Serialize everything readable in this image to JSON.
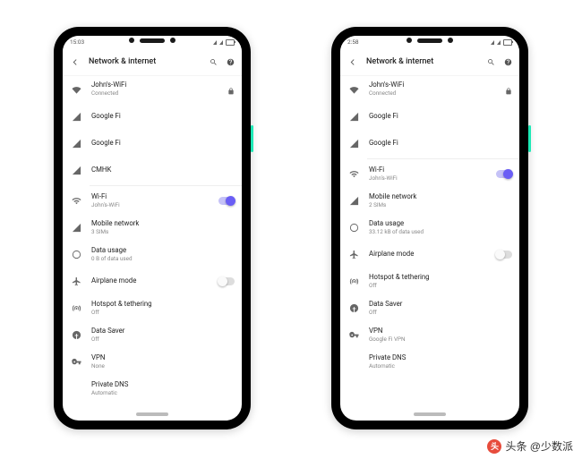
{
  "watermark": "头条 @少数派",
  "phones": [
    {
      "time": "15:03",
      "header_title": "Network & internet",
      "rows": [
        {
          "icon": "wifi-full",
          "label": "John's-WiFi",
          "sub": "Connected",
          "trail": "lock",
          "interact": true
        },
        {
          "icon": "signal",
          "label": "Google Fi",
          "sub": "",
          "trail": "",
          "interact": true
        },
        {
          "icon": "signal",
          "label": "Google Fi",
          "sub": "",
          "trail": "",
          "interact": true
        },
        {
          "icon": "signal",
          "label": "CMHK",
          "sub": "",
          "trail": "",
          "interact": true
        },
        {
          "sep": true
        },
        {
          "icon": "wifi",
          "label": "Wi-Fi",
          "sub": "John's-WiFi",
          "trail": "toggle-on",
          "interact": true
        },
        {
          "icon": "signal",
          "label": "Mobile network",
          "sub": "3 SIMs",
          "trail": "",
          "interact": true
        },
        {
          "icon": "data",
          "label": "Data usage",
          "sub": "0 B of data used",
          "trail": "",
          "interact": true
        },
        {
          "icon": "airplane",
          "label": "Airplane mode",
          "sub": "",
          "trail": "toggle-off",
          "interact": true
        },
        {
          "icon": "hotspot",
          "label": "Hotspot & tethering",
          "sub": "Off",
          "trail": "",
          "interact": true
        },
        {
          "icon": "datasaver",
          "label": "Data Saver",
          "sub": "Off",
          "trail": "",
          "interact": true
        },
        {
          "icon": "vpn",
          "label": "VPN",
          "sub": "None",
          "trail": "",
          "interact": true
        },
        {
          "icon": "indent",
          "label": "Private DNS",
          "sub": "Automatic",
          "trail": "",
          "interact": true
        }
      ]
    },
    {
      "time": "2:58",
      "header_title": "Network & internet",
      "rows": [
        {
          "icon": "wifi-full",
          "label": "John's-WiFi",
          "sub": "Connected",
          "trail": "lock",
          "interact": true
        },
        {
          "icon": "signal",
          "label": "Google Fi",
          "sub": "",
          "trail": "",
          "interact": true
        },
        {
          "icon": "signal",
          "label": "Google Fi",
          "sub": "",
          "trail": "",
          "interact": true
        },
        {
          "sep": true
        },
        {
          "icon": "wifi",
          "label": "Wi-Fi",
          "sub": "John's-WiFi",
          "trail": "toggle-on",
          "interact": true
        },
        {
          "icon": "signal",
          "label": "Mobile network",
          "sub": "2 SIMs",
          "trail": "",
          "interact": true
        },
        {
          "icon": "data",
          "label": "Data usage",
          "sub": "33.12 kB of data used",
          "trail": "",
          "interact": true
        },
        {
          "icon": "airplane",
          "label": "Airplane mode",
          "sub": "",
          "trail": "toggle-off",
          "interact": true
        },
        {
          "icon": "hotspot",
          "label": "Hotspot & tethering",
          "sub": "Off",
          "trail": "",
          "interact": true
        },
        {
          "icon": "datasaver",
          "label": "Data Saver",
          "sub": "Off",
          "trail": "",
          "interact": true
        },
        {
          "icon": "vpn",
          "label": "VPN",
          "sub": "Google Fi VPN",
          "trail": "",
          "interact": true
        },
        {
          "icon": "indent",
          "label": "Private DNS",
          "sub": "Automatic",
          "trail": "",
          "interact": true
        }
      ]
    }
  ]
}
